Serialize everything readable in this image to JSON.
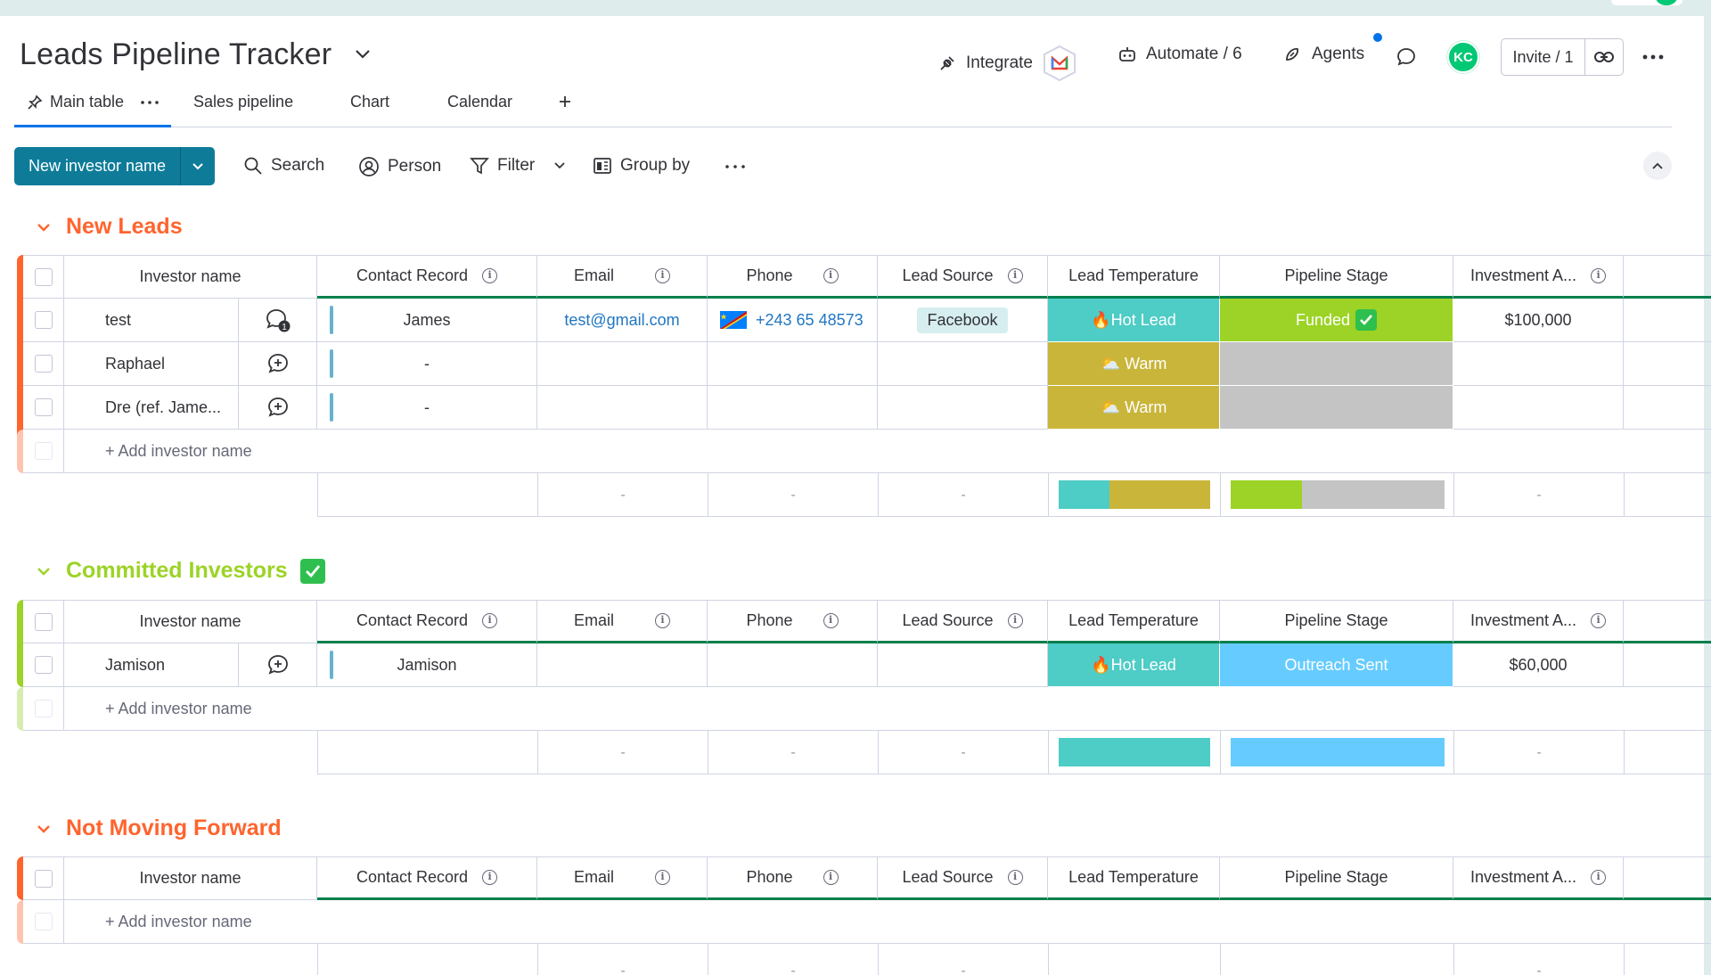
{
  "board": {
    "title": "Leads Pipeline Tracker"
  },
  "header": {
    "integrate": "Integrate",
    "automate": "Automate / 6",
    "agents": "Agents",
    "avatar_initials": "KC",
    "invite": "Invite / 1"
  },
  "tabs": [
    "Main table",
    "Sales pipeline",
    "Chart",
    "Calendar"
  ],
  "toolbar": {
    "new_button": "New investor name",
    "search": "Search",
    "person": "Person",
    "filter": "Filter",
    "group_by": "Group by"
  },
  "columns": [
    "Investor name",
    "Contact Record",
    "Email",
    "Phone",
    "Lead Source",
    "Lead Temperature",
    "Pipeline Stage",
    "Investment A..."
  ],
  "add_row_label": "+ Add investor name",
  "dash": "-",
  "groups": [
    {
      "title": "New Leads",
      "color": "#ff642e",
      "rows": [
        {
          "name": "test",
          "contact": "James",
          "email": "test@gmail.com",
          "phone": "+243 65 48573",
          "source": "Facebook",
          "temp": "🔥Hot Lead",
          "stage": "Funded",
          "amount": "$100,000",
          "update_count": "1"
        },
        {
          "name": "Raphael",
          "contact": "-",
          "email": "",
          "phone": "",
          "source": "",
          "temp": "⛅ Warm",
          "stage": "",
          "amount": ""
        },
        {
          "name": "Dre (ref. Jame...",
          "contact": "-",
          "email": "",
          "phone": "",
          "source": "",
          "temp": "⛅ Warm",
          "stage": "",
          "amount": ""
        }
      ]
    },
    {
      "title": "Committed Investors",
      "color": "#9cd326",
      "rows": [
        {
          "name": "Jamison",
          "contact": "Jamison",
          "email": "",
          "phone": "",
          "source": "",
          "temp": "🔥Hot Lead",
          "stage": "Outreach Sent",
          "amount": "$60,000"
        }
      ]
    },
    {
      "title": "Not Moving Forward",
      "color": "#ff642e",
      "rows": []
    }
  ],
  "status_colors": {
    "hot": "#4eccc6",
    "warm": "#c9b53a",
    "funded": "#9cd326",
    "outreach": "#66ccff",
    "empty": "#c4c4c4"
  }
}
